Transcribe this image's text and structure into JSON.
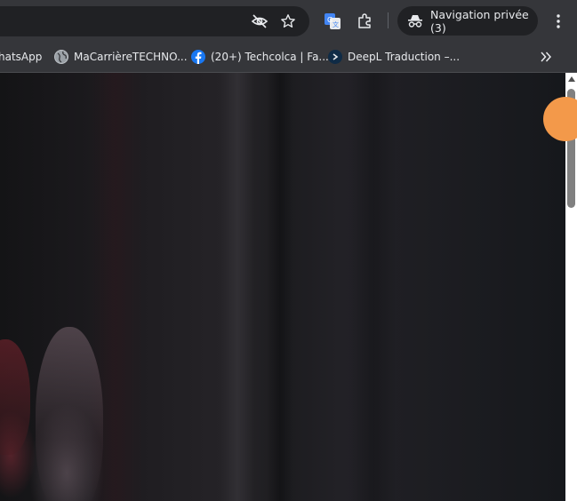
{
  "toolbar": {
    "incognito_label": "Navigation privée (3)",
    "icons": [
      "eye-slash-icon",
      "star-icon",
      "google-translate-icon",
      "extensions-icon",
      "incognito-icon",
      "more-vert-icon"
    ]
  },
  "bookmarks": {
    "items": [
      {
        "label": "hatsApp",
        "icon": "whatsapp-icon"
      },
      {
        "label": "MaCarrièreTECHNO...",
        "icon": "globe-icon"
      },
      {
        "label": "(20+) Techcolca | Fa...",
        "icon": "facebook-icon"
      },
      {
        "label": "DeepL Traduction –...",
        "icon": "deepl-icon"
      }
    ],
    "overflow_icon": "chevron-double-right-icon"
  },
  "colors": {
    "toolbar_bg": "#35363a",
    "omnibox_bg": "#202124",
    "text": "#e8eaed",
    "fab": "#f3994a",
    "facebook": "#1877f2",
    "deepl": "#0f2b46"
  }
}
